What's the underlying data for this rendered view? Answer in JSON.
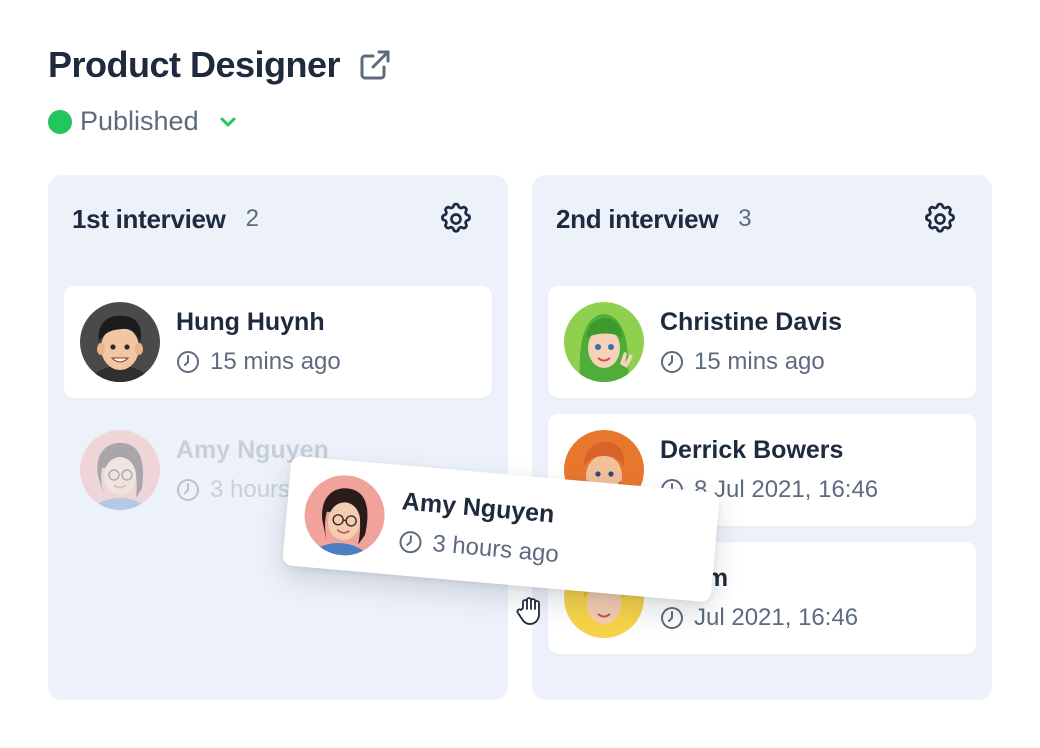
{
  "job": {
    "title": "Product Designer",
    "status": "Published",
    "status_color": "#22c55e"
  },
  "columns": [
    {
      "title": "1st interview",
      "count": "2",
      "cards": [
        {
          "name": "Hung Huynh",
          "time": "15 mins ago",
          "avatar": "memoji-dark-hair"
        },
        {
          "name": "Amy Nguyen",
          "time": "3 hours ago",
          "avatar": "photo-woman-glasses",
          "state": "drag-placeholder"
        }
      ]
    },
    {
      "title": "2nd interview",
      "count": "3",
      "cards": [
        {
          "name": "Christine Davis",
          "time": "15 mins ago",
          "avatar": "memoji-green-hair"
        },
        {
          "name": "Derrick Bowers",
          "time": "8 Jul 2021, 16:46",
          "avatar": "memoji-red-beard"
        },
        {
          "name": "a Kim",
          "time": "Jul 2021, 16:46",
          "avatar": "memoji-blonde",
          "state": "partially-covered"
        }
      ]
    }
  ],
  "dragged_card": {
    "name": "Amy Nguyen",
    "time": "3 hours ago",
    "avatar": "photo-woman-glasses"
  },
  "colors": {
    "text_primary": "#1e2a3d",
    "text_secondary": "#5d6b7f",
    "column_bg": "#edf2fa",
    "card_bg": "#ffffff"
  },
  "icons": {
    "title_action": "external-link-icon",
    "status_toggle": "chevron-down-icon",
    "column_action": "gear-icon",
    "timestamp": "clock-icon",
    "cursor": "grab-hand-cursor"
  }
}
